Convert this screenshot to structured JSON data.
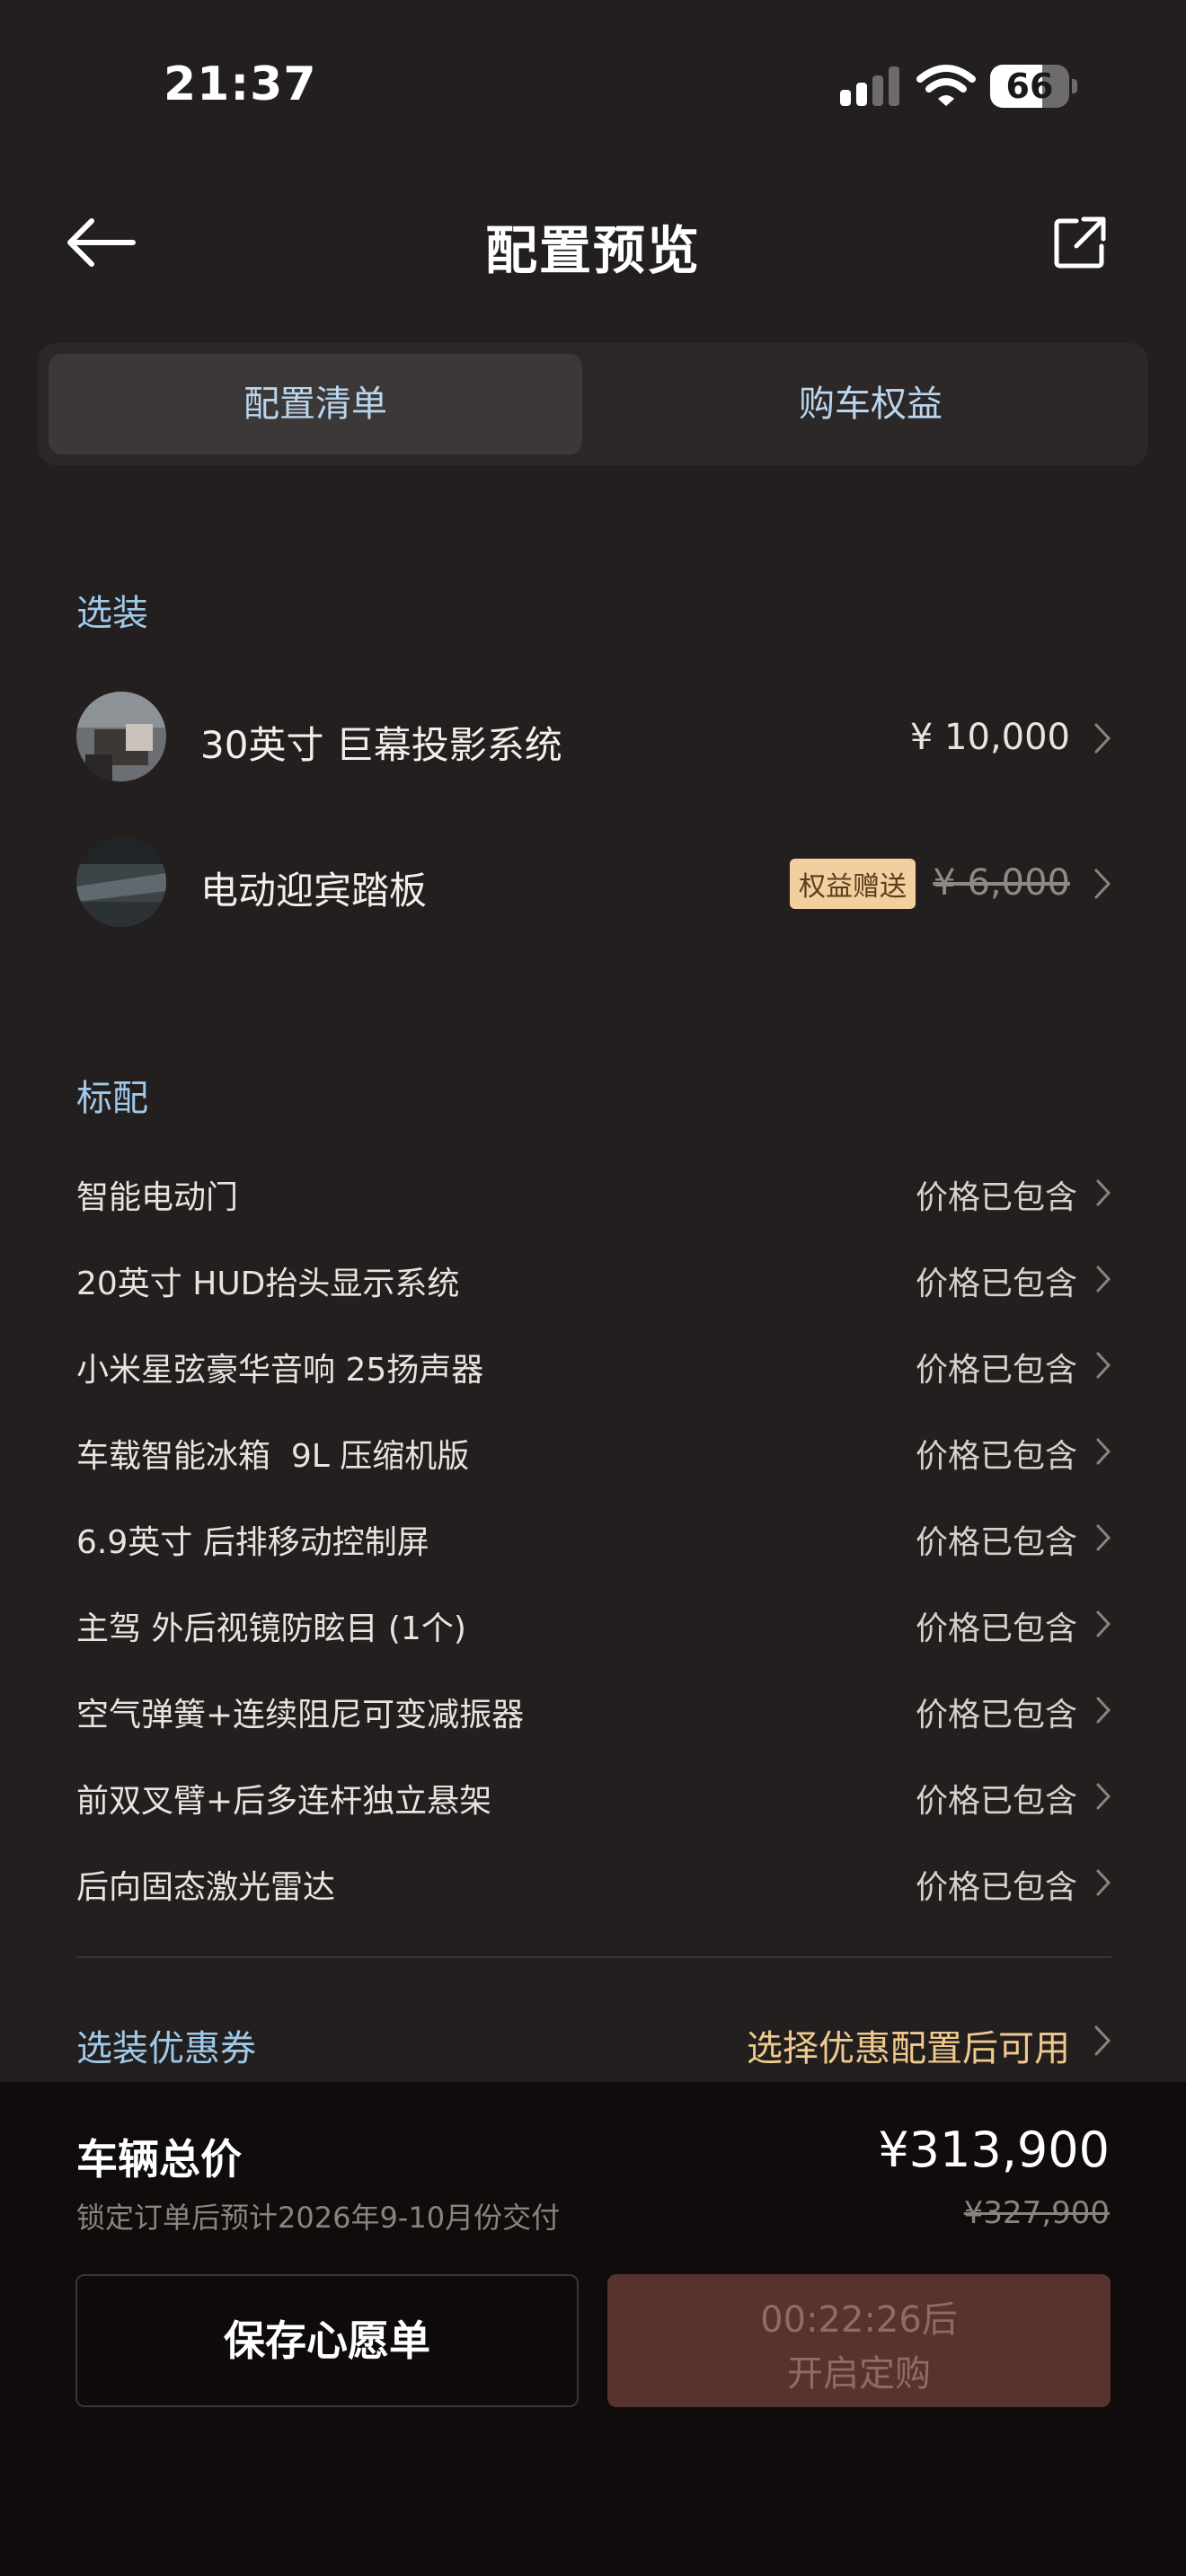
{
  "status_bar": {
    "time": "21:37",
    "battery": "66",
    "battery_level": 0.66
  },
  "header": {
    "title": "配置预览"
  },
  "tabs": [
    {
      "label": "配置清单",
      "active": true
    },
    {
      "label": "购车权益",
      "active": false
    }
  ],
  "options": {
    "title": "选装",
    "items": [
      {
        "name": "30英寸 巨幕投影系统",
        "price": "¥ 10,000",
        "badge": "",
        "strikethrough": false
      },
      {
        "name": "电动迎宾踏板",
        "price": "¥ 6,000",
        "badge": "权益赠送",
        "strikethrough": true
      }
    ]
  },
  "standard": {
    "title": "标配",
    "items": [
      {
        "name": "智能电动门",
        "value": "价格已包含"
      },
      {
        "name": "20英寸 HUD抬头显示系统",
        "value": "价格已包含"
      },
      {
        "name": "小米星弦豪华音响 25扬声器",
        "value": "价格已包含"
      },
      {
        "name": "车载智能冰箱  9L 压缩机版",
        "value": "价格已包含"
      },
      {
        "name": "6.9英寸 后排移动控制屏",
        "value": "价格已包含"
      },
      {
        "name": "主驾 外后视镜防眩目 (1个)",
        "value": "价格已包含"
      },
      {
        "name": "空气弹簧+连续阻尼可变减振器",
        "value": "价格已包含"
      },
      {
        "name": "前双叉臂+后多连杆独立悬架",
        "value": "价格已包含"
      },
      {
        "name": "后向固态激光雷达",
        "value": "价格已包含"
      }
    ]
  },
  "coupon": {
    "label": "选装优惠券",
    "value": "选择优惠配置后可用"
  },
  "footer": {
    "total_label": "车辆总价",
    "total_price": "¥313,900",
    "delivery_note": "锁定订单后预计2026年9-10月份交付",
    "original_price": "¥327,900",
    "save_button": "保存心愿单",
    "order_countdown": "00:22:26后",
    "order_button": "开启定购"
  },
  "colors": {
    "background": "#231f1f",
    "accent_blue": "#9fc9e9",
    "accent_gold": "#efc98d",
    "order_button": "#58322c"
  }
}
